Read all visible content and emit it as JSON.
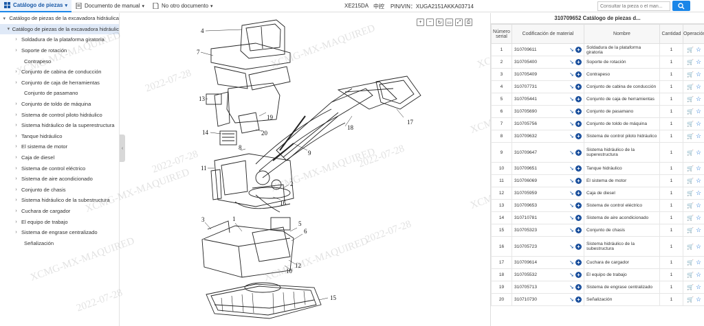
{
  "topbar": {
    "tabs": [
      {
        "label": "Catálogo de piezas",
        "icon": "grid-icon"
      },
      {
        "label": "Documento de manual",
        "icon": "document-icon"
      },
      {
        "label": "No otro documento",
        "icon": "file-icon"
      }
    ],
    "model": "XE215DA",
    "lang": "中控",
    "pin": "PIN/VIN：XUGA2151AKKA03714",
    "search_placeholder": "Consultar la pieza o el man..."
  },
  "sidebar": {
    "root": "Catálogo de piezas de la excavadora hidráulica",
    "selected": "Catálogo de piezas de la excavadora hidráulic",
    "items": [
      {
        "label": "Soldadura de la plataforma giratoria",
        "arrow": true
      },
      {
        "label": "Soporte de rotación",
        "arrow": true
      },
      {
        "label": "Contrapeso",
        "arrow": false
      },
      {
        "label": "Conjunto de cabina de conducción",
        "arrow": true
      },
      {
        "label": "Conjunto de caja de herramientas",
        "arrow": true
      },
      {
        "label": "Conjunto de pasamano",
        "arrow": false
      },
      {
        "label": "Conjunto de toldo de máquina",
        "arrow": true
      },
      {
        "label": "Sistema de control piloto hidráulico",
        "arrow": true
      },
      {
        "label": "Sistema hidráulico de la superestructura",
        "arrow": true
      },
      {
        "label": "Tanque hidráulico",
        "arrow": true
      },
      {
        "label": "El sistema de motor",
        "arrow": true
      },
      {
        "label": "Caja de diesel",
        "arrow": true
      },
      {
        "label": "Sistema de control eléctrico",
        "arrow": true
      },
      {
        "label": "Sistema de aire acondicionado",
        "arrow": true
      },
      {
        "label": "Conjunto de chasis",
        "arrow": true
      },
      {
        "label": "Sistema hidráulico de la subestructura",
        "arrow": true
      },
      {
        "label": "Cuchara de cargador",
        "arrow": true
      },
      {
        "label": "El equipo de trabajo",
        "arrow": true
      },
      {
        "label": "Sistema de engrase centralizado",
        "arrow": true
      },
      {
        "label": "Señalización",
        "arrow": false
      }
    ]
  },
  "diagram": {
    "callouts": [
      "4",
      "7",
      "13",
      "14",
      "11",
      "8",
      "19",
      "20",
      "9",
      "18",
      "17",
      "2",
      "16",
      "3",
      "1",
      "5",
      "6",
      "10",
      "12",
      "15"
    ],
    "watermark_text": "XCMG-MX-MAQUIRED",
    "watermark_date": "2022-07-28"
  },
  "table": {
    "title": "310709652 Catálogo de piezas d...",
    "headers": {
      "num": "Número serial",
      "code": "Codificación de material",
      "name": "Nombre",
      "qty": "Cantidad",
      "ops": "Operación"
    },
    "rows": [
      {
        "num": "1",
        "code": "310709611",
        "name": "Soldadura de la plataforma giratoria",
        "qty": "1"
      },
      {
        "num": "2",
        "code": "310705400",
        "name": "Soporte de rotación",
        "qty": "1"
      },
      {
        "num": "3",
        "code": "310705409",
        "name": "Contrapeso",
        "qty": "1"
      },
      {
        "num": "4",
        "code": "310707731",
        "name": "Conjunto de cabina de conducción",
        "qty": "1"
      },
      {
        "num": "5",
        "code": "310705441",
        "name": "Conjunto de caja de herramientas",
        "qty": "1"
      },
      {
        "num": "6",
        "code": "310705690",
        "name": "Conjunto de pasamano",
        "qty": "1"
      },
      {
        "num": "7",
        "code": "310705756",
        "name": "Conjunto de toldo de máquina",
        "qty": "1"
      },
      {
        "num": "8",
        "code": "310709632",
        "name": "Sistema de control piloto hidráulico",
        "qty": "1"
      },
      {
        "num": "9",
        "code": "310709647",
        "name": "Sistema hidráulico de la superestructura",
        "qty": "1",
        "tall": true
      },
      {
        "num": "10",
        "code": "310709651",
        "name": "Tanque hidráulico",
        "qty": "1"
      },
      {
        "num": "11",
        "code": "310706069",
        "name": "El sistema de motor",
        "qty": "1"
      },
      {
        "num": "12",
        "code": "310705959",
        "name": "Caja de diesel",
        "qty": "1"
      },
      {
        "num": "13",
        "code": "310709653",
        "name": "Sistema de control eléctrico",
        "qty": "1"
      },
      {
        "num": "14",
        "code": "310710781",
        "name": "Sistema de aire acondicionado",
        "qty": "1"
      },
      {
        "num": "15",
        "code": "310705323",
        "name": "Conjunto de chasis",
        "qty": "1"
      },
      {
        "num": "16",
        "code": "310705723",
        "name": "Sistema hidráulico de la subestructura",
        "qty": "1",
        "tall": true
      },
      {
        "num": "17",
        "code": "310709614",
        "name": "Cuchara de cargador",
        "qty": "1"
      },
      {
        "num": "18",
        "code": "310705532",
        "name": "El equipo de trabajo",
        "qty": "1"
      },
      {
        "num": "19",
        "code": "310705713",
        "name": "Sistema de engrase centralizado",
        "qty": "1"
      },
      {
        "num": "20",
        "code": "310710730",
        "name": "Señalización",
        "qty": "1"
      }
    ]
  },
  "colors": {
    "accent": "#1a86e8",
    "selected_bg": "#dfe9f7",
    "star": "#1a6fd6",
    "plus": "#1a4f9c"
  }
}
